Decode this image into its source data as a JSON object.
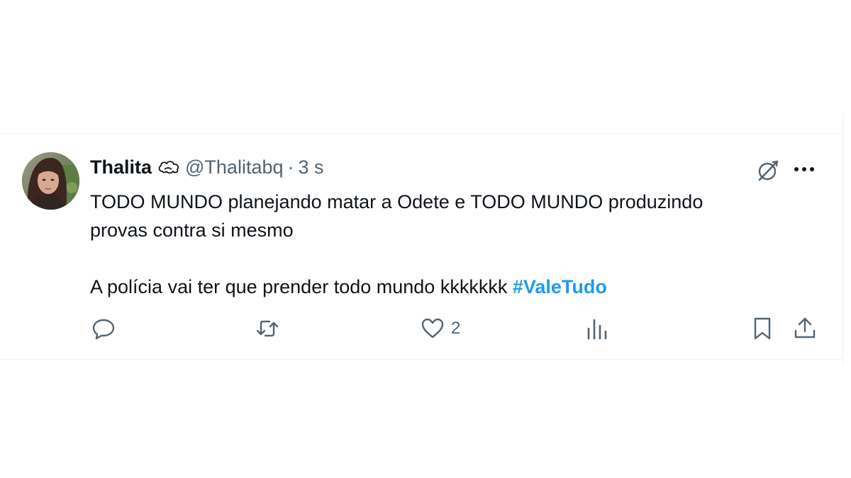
{
  "tweet": {
    "author_name": "Thalita",
    "handle": "@Thalitabq",
    "separator": "·",
    "time": "3 s",
    "text_line1": "TODO MUNDO planejando matar a Odete e TODO MUNDO produzindo",
    "text_line2": "provas contra si mesmo",
    "text_line3": "A polícia vai ter que prender todo mundo kkkkkkk",
    "hashtag": "#ValeTudo"
  },
  "actions": {
    "likes_count": "2"
  },
  "icons": {
    "avatar": "avatar-photo",
    "badge": "cloud-badge-icon",
    "grok": "grok-icon",
    "more": "more-dots-icon",
    "reply": "reply-icon",
    "repost": "repost-icon",
    "like": "heart-icon",
    "views": "views-chart-icon",
    "bookmark": "bookmark-icon",
    "share": "share-icon"
  },
  "colors": {
    "text": "#0f1419",
    "muted": "#536471",
    "link": "#1d9bf0",
    "border": "#eff3f4"
  }
}
